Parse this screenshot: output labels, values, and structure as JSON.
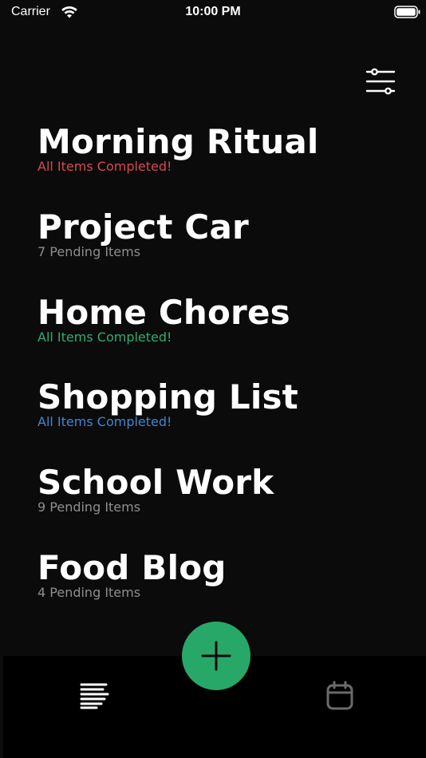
{
  "status_bar": {
    "carrier": "Carrier",
    "time": "10:00 PM"
  },
  "header": {
    "filter_icon": "sliders-icon"
  },
  "lists": [
    {
      "title": "Morning Ritual",
      "status": "All Items Completed!",
      "status_color": "#d9484e"
    },
    {
      "title": "Project Car",
      "status": "7 Pending Items",
      "status_color": "#8e8e8e"
    },
    {
      "title": "Home Chores",
      "status": "All Items Completed!",
      "status_color": "#2eae6e"
    },
    {
      "title": "Shopping List",
      "status": "All Items Completed!",
      "status_color": "#3f86d4"
    },
    {
      "title": "School Work",
      "status": "9 Pending Items",
      "status_color": "#8e8e8e"
    },
    {
      "title": "Food Blog",
      "status": "4 Pending Items",
      "status_color": "#8e8e8e"
    }
  ],
  "fab": {
    "icon": "plus-icon",
    "color": "#28a868"
  },
  "tab_bar": {
    "tabs": [
      {
        "icon": "lists-icon",
        "active": true
      },
      {
        "icon": "calendar-icon",
        "active": false
      }
    ]
  },
  "colors": {
    "background": "#0b0b0b",
    "tab_bar": "#000000",
    "text": "#ffffff",
    "inactive_icon": "#6a6a6a"
  }
}
